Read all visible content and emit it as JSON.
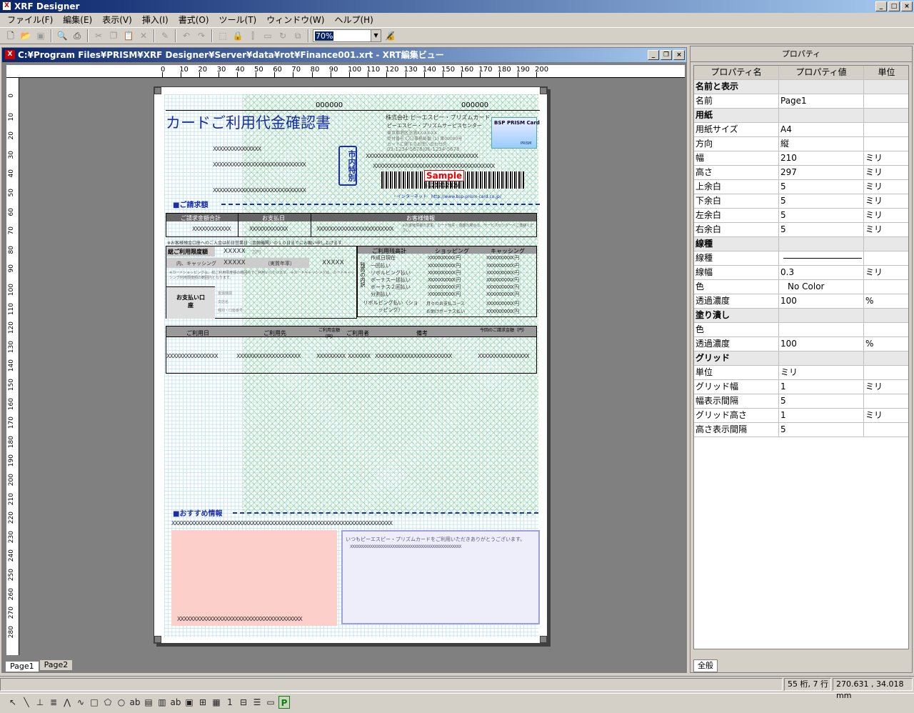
{
  "app": {
    "title": "XRF Designer",
    "icon": "xrf-app-icon"
  },
  "menu": [
    "ファイル(F)",
    "編集(E)",
    "表示(V)",
    "挿入(I)",
    "書式(O)",
    "ツール(T)",
    "ウィンドウ(W)",
    "ヘルプ(H)"
  ],
  "toolbar": {
    "zoom": "70%",
    "icons": [
      "new-file-icon",
      "open-folder-icon",
      "save-icon",
      "print-preview-icon",
      "print-icon",
      "cut-icon",
      "copy-icon",
      "paste-icon",
      "delete-icon",
      "format-painter-icon",
      "undo-icon",
      "redo-icon",
      "select-region-icon",
      "lock-icon",
      "align-icon",
      "distribute-icon",
      "rotate-icon",
      "group-icon",
      "zoom-dropdown",
      "lock-disabled-icon"
    ]
  },
  "document": {
    "title": "C:¥Program Files¥PRISM¥XRF Designer¥Server¥data¥rot¥Finance001.xrt - XRT編集ビュー",
    "ruler_labels": [
      "0",
      "10",
      "20",
      "30",
      "40",
      "50",
      "60",
      "70",
      "80",
      "90",
      "100",
      "110",
      "120",
      "130",
      "140",
      "150",
      "160",
      "170",
      "180",
      "190",
      "200"
    ],
    "vruler_labels": [
      "0",
      "10",
      "20",
      "30",
      "40",
      "50",
      "60",
      "70",
      "80",
      "90",
      "100",
      "110",
      "120",
      "130",
      "140",
      "150",
      "160",
      "170",
      "180",
      "190",
      "200",
      "210",
      "220",
      "230",
      "240",
      "250",
      "260",
      "270",
      "280"
    ],
    "form": {
      "heading": "カードご利用代金確認書",
      "code1": "000000",
      "code2": "000000",
      "company": "株式会社 ピーエスピー・プリズムカード",
      "center": "ピーエスピー・プリズムサービスセンター",
      "address1": "東京都港区芝浦XX-XX-XX",
      "address2": "受付番号 〇〇事務局番 (1) 第00000号",
      "address3": "カードに関するお問い合わせ先",
      "phone": "03-1234-5678/06-1234-5678",
      "card_logo": "BSP PRISM Card",
      "card_sub": "PRISM",
      "stamp": "市内特別",
      "barcode_text": "a12121212a",
      "sample": "Sample",
      "internet": "・インターネット　http://www.bsp-prism-card.co.jp/",
      "section_billing": "■ご請求額",
      "billing_headers": [
        "ご請求金額合計",
        "お支払日",
        "お客様情報"
      ],
      "billing_values": [
        "XXXXXXXXXXXX",
        "XXXXXXXXXXXX",
        "XXXXXXXXXXXXXXXXXXXXXXXX"
      ],
      "customer_note": "※お客様情報の変更、カード紛失・盗難の場合は、サービスセンターへご連絡ください。",
      "payment_note": "※お客様預金口座へのご入金は前日営業日（金融機関）の１０日までにお願い申し上げます",
      "limit_label": "総ご利用限度額",
      "limit_value": "XXXXX",
      "limit_unit": "万円",
      "cashing_label": "内、キャッシング",
      "cashing_value": "XXXXX",
      "cashing_rate": "（実質年率）",
      "cashing_rate_value": "XXXXX",
      "limit_notes": "※カードショッピングは、総ご利用限度額の範囲内でご利用いただけます。 ※カードキャッシングは、カードキャッシング利用限度額の範囲内となります。",
      "balance_header": [
        "ご利用残高計",
        "ショッピング",
        "キャッシング"
      ],
      "balance_rows": [
        "作成日現在",
        "一回払い",
        "リボルビング払い",
        "ボーナス一括払い",
        "ボーナス２回払い",
        "分割払い"
      ],
      "balance_side": "残高の内訳",
      "revo_label": "リボルビング払い（ショッピング）",
      "revo_rows": [
        "月々のお支払コース",
        "お助けボーナス払い"
      ],
      "xamount": "XXXXXXXXXX 円",
      "account_label": "お支払い口座",
      "account_fields": [
        "金融機関",
        "支店名",
        "種別・口座番号"
      ],
      "detail_headers": [
        "ご利用日",
        "ご利用先",
        "ご利用金額（円）",
        "ご利用者",
        "備考",
        "今回のご請求金額（円）"
      ],
      "detail_row": [
        "XXXXXXXXXXXXXXXX",
        "XXXXXXXXXXXXXXXXXXXX",
        "XXXXXXXXX",
        "XXXXXXX",
        "XXXXXXXXXXXXXXXXXXXXXXXX",
        "XXXXXXXXXXXXXXXX"
      ],
      "section_reco": "■おすすめ情報",
      "reco_line": "XXXXXXXXXXXXXXXXXXXXXXXXXXXXXXXXXXXXXXXXXXXXXXXXXXXXXXXXXXXXXXXXXXXXX",
      "reco_box_bottom": "XXXXXXXXXXXXXXXXXXXXXXXXXXXXXXXXXXXXXXX",
      "thanks": "いつもピーエスピー・プリズムカードをご利用いただきありがとうございます。",
      "thanks_x": "XXXXXXXXXXXXXXXXXXXXXXXXXXXXXXXXXXXXXXXXXXXXXXXXXX",
      "addr_x1": "XXXXXXXXXXXXXXX",
      "addr_x2": "XXXXXXXXXXXXXXXXXXXXXXXXXXXXX",
      "addr_x3": "XXXXXXXXXXXXXXXXXXXXXXXXXXXXX",
      "right_x1": "XXXXXXXXXXXXXXXXXXXXXXXXXXXXXXXXXXX",
      "right_x2": "XXXXXXXXXXXXXXXXXXXXXXXXXXXXXXXXXXXXXX"
    },
    "tabs": [
      "Page1",
      "Page2"
    ]
  },
  "properties": {
    "title": "プロパティ",
    "headers": [
      "プロパティ名",
      "プロパティ値",
      "単位"
    ],
    "rows": [
      {
        "name": "名前と表示",
        "value": "",
        "unit": "",
        "group": true
      },
      {
        "name": "名前",
        "value": "Page1",
        "unit": ""
      },
      {
        "name": "用紙",
        "value": "",
        "unit": "",
        "group": true
      },
      {
        "name": "用紙サイズ",
        "value": "A4",
        "unit": ""
      },
      {
        "name": "方向",
        "value": "縦",
        "unit": ""
      },
      {
        "name": "幅",
        "value": "210",
        "unit": "ミリ"
      },
      {
        "name": "高さ",
        "value": "297",
        "unit": "ミリ"
      },
      {
        "name": "上余白",
        "value": "5",
        "unit": "ミリ"
      },
      {
        "name": "下余白",
        "value": "5",
        "unit": "ミリ"
      },
      {
        "name": "左余白",
        "value": "5",
        "unit": "ミリ"
      },
      {
        "name": "右余白",
        "value": "5",
        "unit": "ミリ"
      },
      {
        "name": "線種",
        "value": "",
        "unit": "",
        "group": true
      },
      {
        "name": "線種",
        "value": "",
        "unit": "",
        "line": true
      },
      {
        "name": "線幅",
        "value": "0.3",
        "unit": "ミリ"
      },
      {
        "name": "色",
        "value": "No Color",
        "unit": "",
        "center": true
      },
      {
        "name": "透過濃度",
        "value": "100",
        "unit": "%"
      },
      {
        "name": "塗り潰し",
        "value": "",
        "unit": "",
        "group": true
      },
      {
        "name": "色",
        "value": "",
        "unit": ""
      },
      {
        "name": "透過濃度",
        "value": "100",
        "unit": "%"
      },
      {
        "name": "グリッド",
        "value": "",
        "unit": "",
        "group": true
      },
      {
        "name": "単位",
        "value": "ミリ",
        "unit": ""
      },
      {
        "name": "グリッド幅",
        "value": "1",
        "unit": "ミリ"
      },
      {
        "name": "幅表示間隔",
        "value": "5",
        "unit": ""
      },
      {
        "name": "グリッド高さ",
        "value": "1",
        "unit": "ミリ"
      },
      {
        "name": "高さ表示間隔",
        "value": "5",
        "unit": ""
      }
    ],
    "tab": "全般"
  },
  "status": {
    "position": "55 桁, 7 行",
    "coords": "270.631 , 34.018 mm"
  },
  "drawbar": [
    "pointer-icon",
    "line-icon",
    "perpendicular-icon",
    "hatch-icon",
    "polyline-icon",
    "curve-icon",
    "rectangle-icon",
    "polygon-icon",
    "ellipse-icon",
    "text-icon",
    "image-icon",
    "barcode-icon",
    "field-icon",
    "picture-icon",
    "table-icon",
    "chart-icon",
    "column-icon",
    "grid-icon",
    "layout-icon",
    "border-icon",
    "page-icon"
  ]
}
